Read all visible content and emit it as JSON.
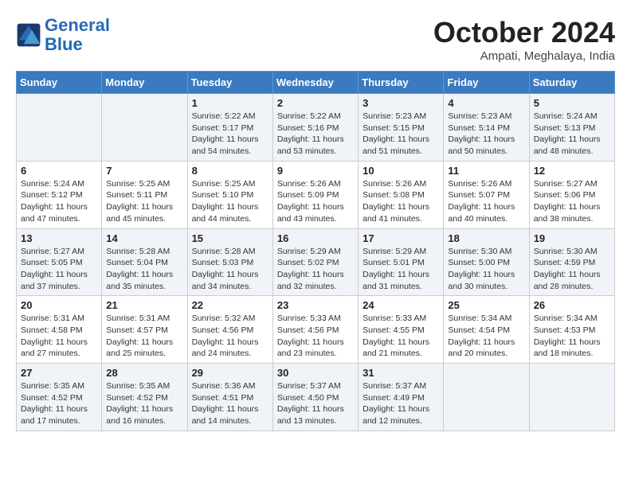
{
  "logo": {
    "line1": "General",
    "line2": "Blue"
  },
  "title": "October 2024",
  "location": "Ampati, Meghalaya, India",
  "days_of_week": [
    "Sunday",
    "Monday",
    "Tuesday",
    "Wednesday",
    "Thursday",
    "Friday",
    "Saturday"
  ],
  "weeks": [
    [
      {
        "day": "",
        "sunrise": "",
        "sunset": "",
        "daylight": ""
      },
      {
        "day": "",
        "sunrise": "",
        "sunset": "",
        "daylight": ""
      },
      {
        "day": "1",
        "sunrise": "Sunrise: 5:22 AM",
        "sunset": "Sunset: 5:17 PM",
        "daylight": "Daylight: 11 hours and 54 minutes."
      },
      {
        "day": "2",
        "sunrise": "Sunrise: 5:22 AM",
        "sunset": "Sunset: 5:16 PM",
        "daylight": "Daylight: 11 hours and 53 minutes."
      },
      {
        "day": "3",
        "sunrise": "Sunrise: 5:23 AM",
        "sunset": "Sunset: 5:15 PM",
        "daylight": "Daylight: 11 hours and 51 minutes."
      },
      {
        "day": "4",
        "sunrise": "Sunrise: 5:23 AM",
        "sunset": "Sunset: 5:14 PM",
        "daylight": "Daylight: 11 hours and 50 minutes."
      },
      {
        "day": "5",
        "sunrise": "Sunrise: 5:24 AM",
        "sunset": "Sunset: 5:13 PM",
        "daylight": "Daylight: 11 hours and 48 minutes."
      }
    ],
    [
      {
        "day": "6",
        "sunrise": "Sunrise: 5:24 AM",
        "sunset": "Sunset: 5:12 PM",
        "daylight": "Daylight: 11 hours and 47 minutes."
      },
      {
        "day": "7",
        "sunrise": "Sunrise: 5:25 AM",
        "sunset": "Sunset: 5:11 PM",
        "daylight": "Daylight: 11 hours and 45 minutes."
      },
      {
        "day": "8",
        "sunrise": "Sunrise: 5:25 AM",
        "sunset": "Sunset: 5:10 PM",
        "daylight": "Daylight: 11 hours and 44 minutes."
      },
      {
        "day": "9",
        "sunrise": "Sunrise: 5:26 AM",
        "sunset": "Sunset: 5:09 PM",
        "daylight": "Daylight: 11 hours and 43 minutes."
      },
      {
        "day": "10",
        "sunrise": "Sunrise: 5:26 AM",
        "sunset": "Sunset: 5:08 PM",
        "daylight": "Daylight: 11 hours and 41 minutes."
      },
      {
        "day": "11",
        "sunrise": "Sunrise: 5:26 AM",
        "sunset": "Sunset: 5:07 PM",
        "daylight": "Daylight: 11 hours and 40 minutes."
      },
      {
        "day": "12",
        "sunrise": "Sunrise: 5:27 AM",
        "sunset": "Sunset: 5:06 PM",
        "daylight": "Daylight: 11 hours and 38 minutes."
      }
    ],
    [
      {
        "day": "13",
        "sunrise": "Sunrise: 5:27 AM",
        "sunset": "Sunset: 5:05 PM",
        "daylight": "Daylight: 11 hours and 37 minutes."
      },
      {
        "day": "14",
        "sunrise": "Sunrise: 5:28 AM",
        "sunset": "Sunset: 5:04 PM",
        "daylight": "Daylight: 11 hours and 35 minutes."
      },
      {
        "day": "15",
        "sunrise": "Sunrise: 5:28 AM",
        "sunset": "Sunset: 5:03 PM",
        "daylight": "Daylight: 11 hours and 34 minutes."
      },
      {
        "day": "16",
        "sunrise": "Sunrise: 5:29 AM",
        "sunset": "Sunset: 5:02 PM",
        "daylight": "Daylight: 11 hours and 32 minutes."
      },
      {
        "day": "17",
        "sunrise": "Sunrise: 5:29 AM",
        "sunset": "Sunset: 5:01 PM",
        "daylight": "Daylight: 11 hours and 31 minutes."
      },
      {
        "day": "18",
        "sunrise": "Sunrise: 5:30 AM",
        "sunset": "Sunset: 5:00 PM",
        "daylight": "Daylight: 11 hours and 30 minutes."
      },
      {
        "day": "19",
        "sunrise": "Sunrise: 5:30 AM",
        "sunset": "Sunset: 4:59 PM",
        "daylight": "Daylight: 11 hours and 28 minutes."
      }
    ],
    [
      {
        "day": "20",
        "sunrise": "Sunrise: 5:31 AM",
        "sunset": "Sunset: 4:58 PM",
        "daylight": "Daylight: 11 hours and 27 minutes."
      },
      {
        "day": "21",
        "sunrise": "Sunrise: 5:31 AM",
        "sunset": "Sunset: 4:57 PM",
        "daylight": "Daylight: 11 hours and 25 minutes."
      },
      {
        "day": "22",
        "sunrise": "Sunrise: 5:32 AM",
        "sunset": "Sunset: 4:56 PM",
        "daylight": "Daylight: 11 hours and 24 minutes."
      },
      {
        "day": "23",
        "sunrise": "Sunrise: 5:33 AM",
        "sunset": "Sunset: 4:56 PM",
        "daylight": "Daylight: 11 hours and 23 minutes."
      },
      {
        "day": "24",
        "sunrise": "Sunrise: 5:33 AM",
        "sunset": "Sunset: 4:55 PM",
        "daylight": "Daylight: 11 hours and 21 minutes."
      },
      {
        "day": "25",
        "sunrise": "Sunrise: 5:34 AM",
        "sunset": "Sunset: 4:54 PM",
        "daylight": "Daylight: 11 hours and 20 minutes."
      },
      {
        "day": "26",
        "sunrise": "Sunrise: 5:34 AM",
        "sunset": "Sunset: 4:53 PM",
        "daylight": "Daylight: 11 hours and 18 minutes."
      }
    ],
    [
      {
        "day": "27",
        "sunrise": "Sunrise: 5:35 AM",
        "sunset": "Sunset: 4:52 PM",
        "daylight": "Daylight: 11 hours and 17 minutes."
      },
      {
        "day": "28",
        "sunrise": "Sunrise: 5:35 AM",
        "sunset": "Sunset: 4:52 PM",
        "daylight": "Daylight: 11 hours and 16 minutes."
      },
      {
        "day": "29",
        "sunrise": "Sunrise: 5:36 AM",
        "sunset": "Sunset: 4:51 PM",
        "daylight": "Daylight: 11 hours and 14 minutes."
      },
      {
        "day": "30",
        "sunrise": "Sunrise: 5:37 AM",
        "sunset": "Sunset: 4:50 PM",
        "daylight": "Daylight: 11 hours and 13 minutes."
      },
      {
        "day": "31",
        "sunrise": "Sunrise: 5:37 AM",
        "sunset": "Sunset: 4:49 PM",
        "daylight": "Daylight: 11 hours and 12 minutes."
      },
      {
        "day": "",
        "sunrise": "",
        "sunset": "",
        "daylight": ""
      },
      {
        "day": "",
        "sunrise": "",
        "sunset": "",
        "daylight": ""
      }
    ]
  ]
}
